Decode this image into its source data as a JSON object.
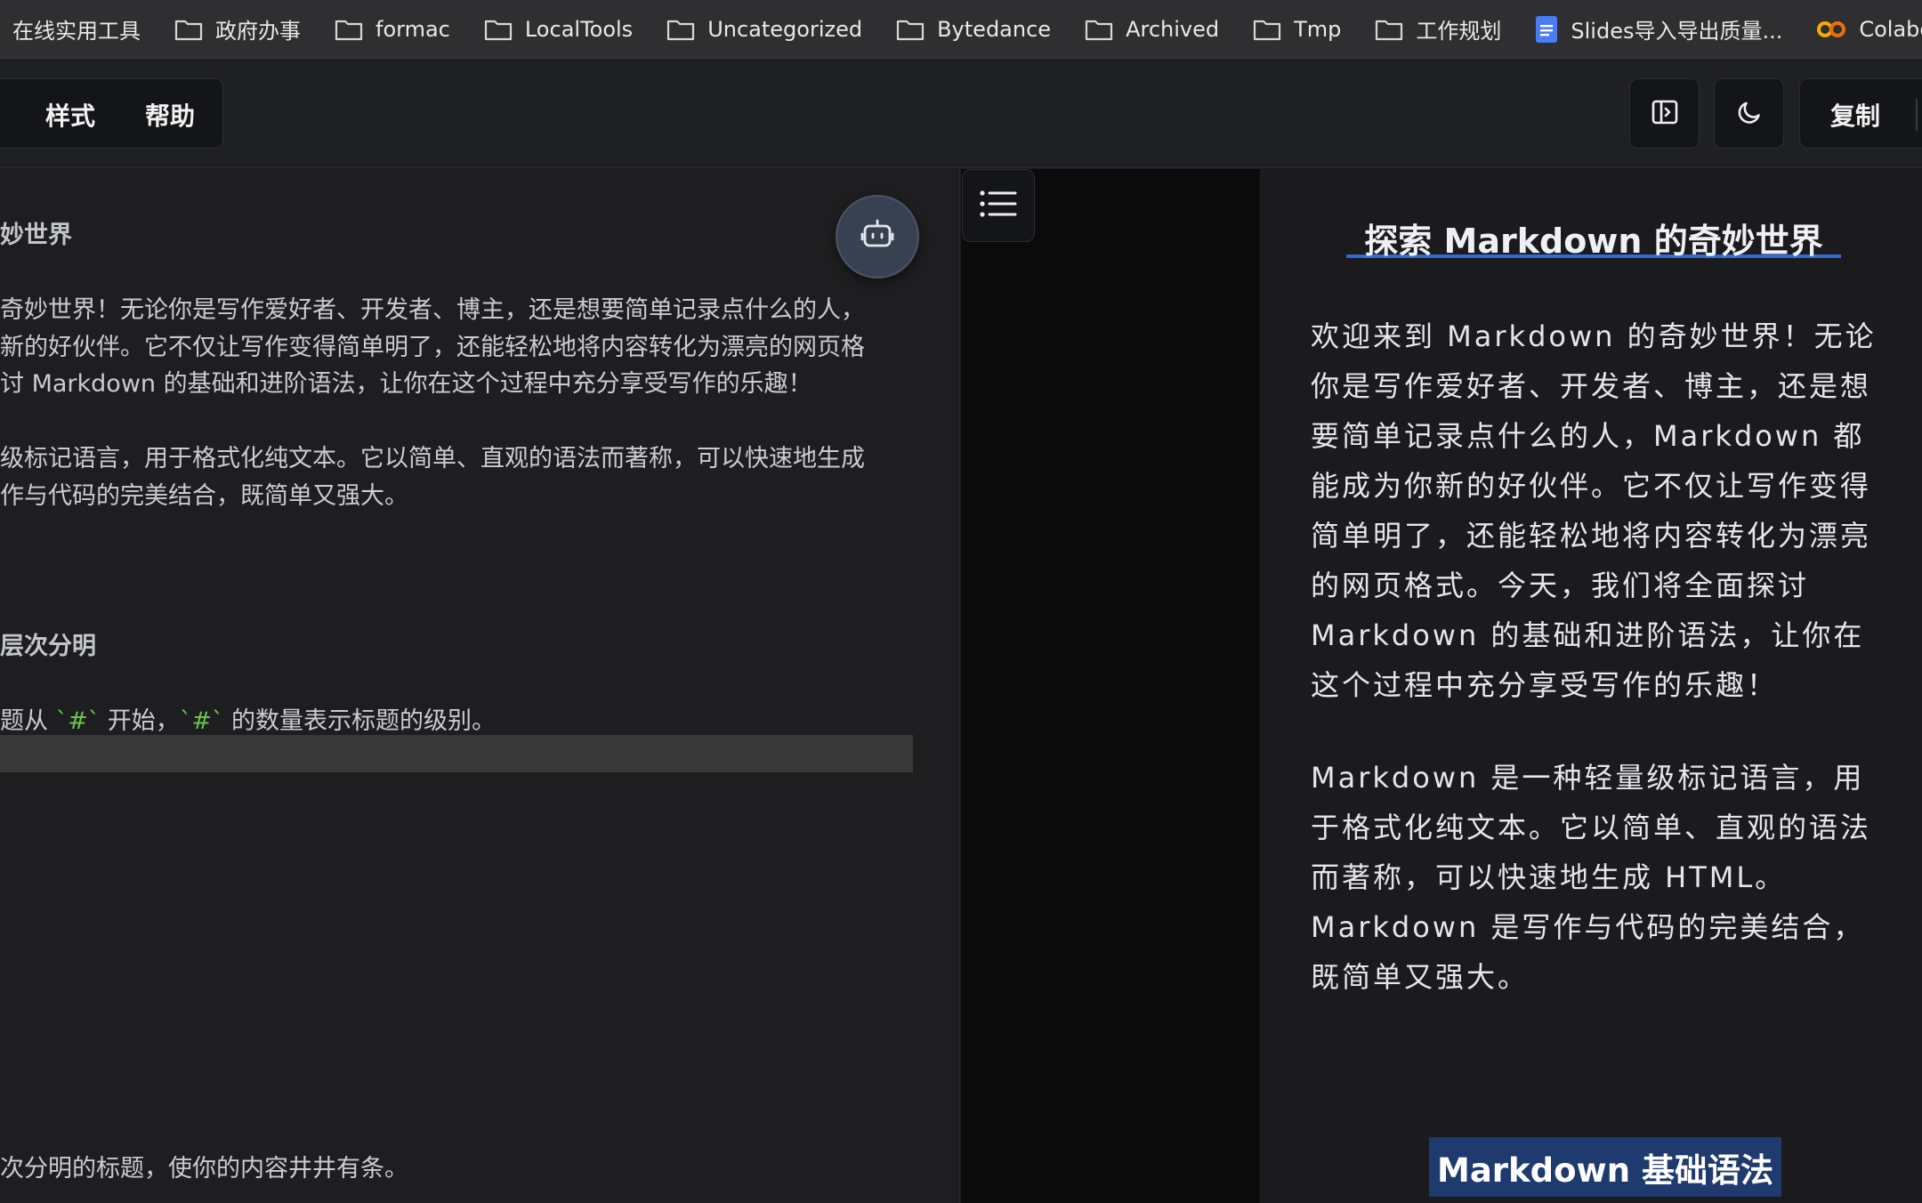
{
  "bookmarks": [
    {
      "label": "在线实用工具",
      "icon": "none"
    },
    {
      "label": "政府办事",
      "icon": "folder-icon"
    },
    {
      "label": "formac",
      "icon": "folder-icon"
    },
    {
      "label": "LocalTools",
      "icon": "folder-icon"
    },
    {
      "label": "Uncategorized",
      "icon": "folder-icon"
    },
    {
      "label": "Bytedance",
      "icon": "folder-icon"
    },
    {
      "label": "Archived",
      "icon": "folder-icon"
    },
    {
      "label": "Tmp",
      "icon": "folder-icon"
    },
    {
      "label": "工作规划",
      "icon": "folder-icon"
    },
    {
      "label": "Slides导入导出质量...",
      "icon": "google-slides-icon"
    },
    {
      "label": "Colaborat",
      "icon": "colab-icon"
    }
  ],
  "toolbar": {
    "menu": [
      {
        "label": "样式"
      },
      {
        "label": "帮助"
      }
    ],
    "copy_label": "复制",
    "icons": [
      "sidebar-toggle-icon",
      "moon-icon"
    ]
  },
  "editor": {
    "lines": [
      "妙世界",
      "奇妙世界！无论你是写作爱好者、开发者、博主，还是想要简单记录点什么的人，",
      "新的好伙伴。它不仅让写作变得简单明了，还能轻松地将内容转化为漂亮的网页格",
      "讨 Markdown 的基础和进阶语法，让你在这个过程中充分享受写作的乐趣！",
      "级标记语言，用于格式化纯文本。它以简单、直观的语法而著称，可以快速地生成",
      "作与代码的完美结合，既简单又强大。",
      "层次分明",
      "题从 ",
      "`#`",
      " 开始，",
      "`#`",
      " 的数量表示标题的级别。",
      "次分明的标题，使你的内容井井有条。"
    ]
  },
  "preview": {
    "title": "探索 Markdown 的奇妙世界",
    "paragraphs": [
      "欢迎来到 Markdown 的奇妙世界！无论你是写作爱好者、开发者、博主，还是想要简单记录点什么的人，Markdown 都能成为你新的好伙伴。它不仅让写作变得简单明了，还能轻松地将内容转化为漂亮的网页格式。今天，我们将全面探讨 Markdown 的基础和进阶语法，让你在这个过程中充分享受写作的乐趣！",
      "Markdown 是一种轻量级标记语言，用于格式化纯文本。它以简单、直观的语法而著称，可以快速地生成 HTML。Markdown 是写作与代码的完美结合，既简单又强大。"
    ],
    "h2": "Markdown 基础语法"
  },
  "colors": {
    "accent": "#2f6bd4",
    "heading_highlight": "#1e3a6e",
    "inline_code": "#6cc24a"
  }
}
